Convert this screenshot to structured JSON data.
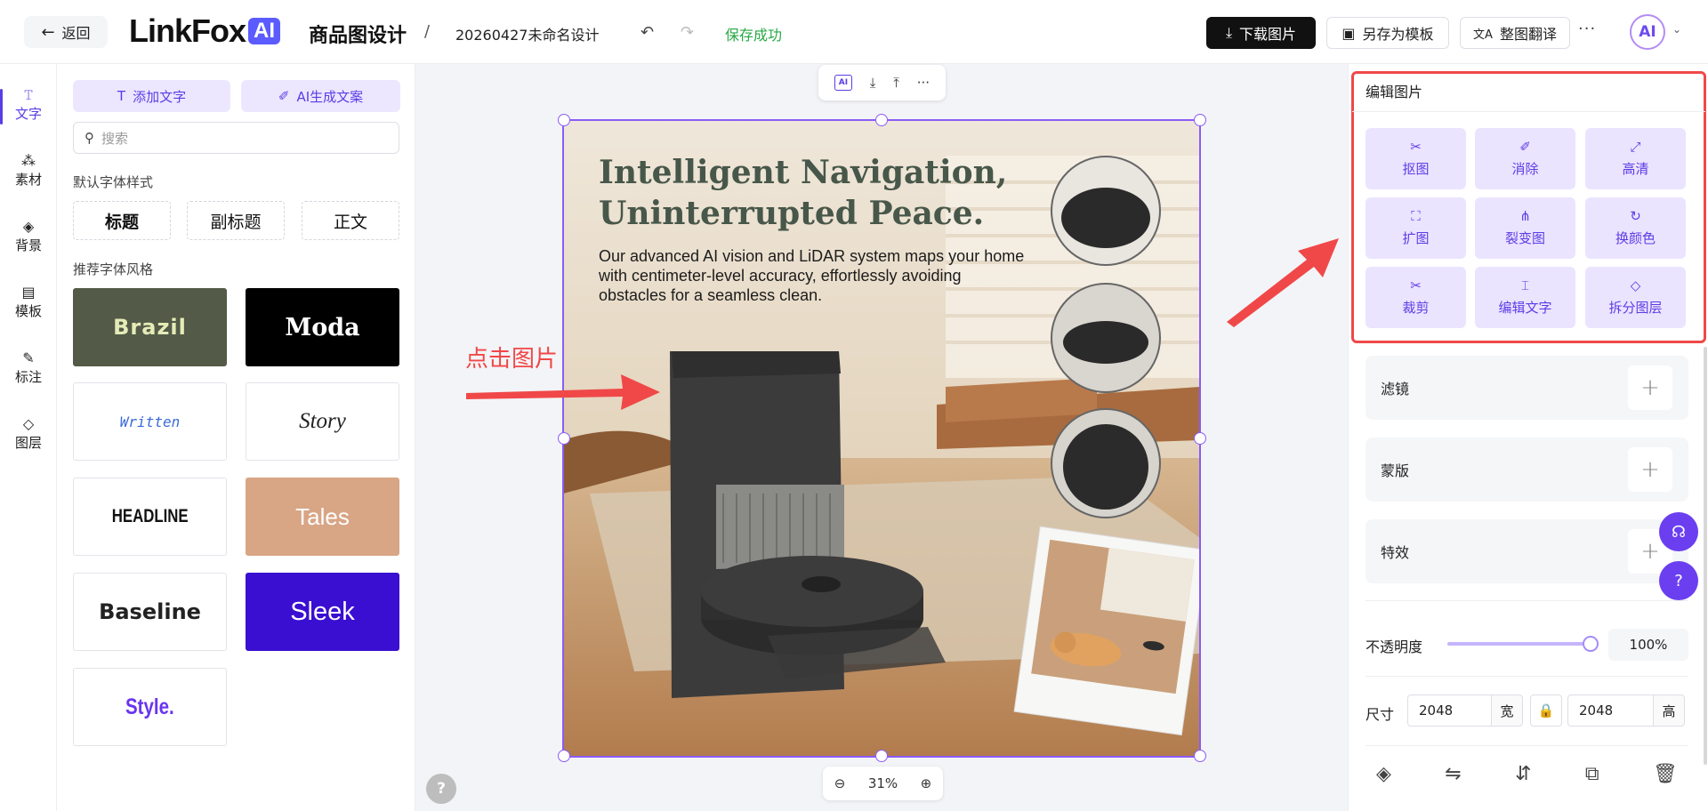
{
  "header": {
    "back_label": "返回",
    "logo_text": "LinkFox",
    "logo_badge": "AI",
    "app_title": "商品图设计",
    "separator": "/",
    "doc_name": "20260427未命名设计",
    "undo_icon": "undo-icon",
    "redo_icon": "redo-icon",
    "save_status": "保存成功",
    "download_label": "下载图片",
    "save_template_label": "另存为模板",
    "translate_label": "整图翻译",
    "more": "···",
    "avatar_text": "AI"
  },
  "rail": {
    "items": [
      {
        "label": "文字",
        "icon": "text-icon",
        "active": true
      },
      {
        "label": "素材",
        "icon": "assets-icon"
      },
      {
        "label": "背景",
        "icon": "background-icon"
      },
      {
        "label": "模板",
        "icon": "template-icon"
      },
      {
        "label": "标注",
        "icon": "annotate-icon"
      },
      {
        "label": "图层",
        "icon": "layers-icon"
      }
    ]
  },
  "text_panel": {
    "add_text_label": "添加文字",
    "ai_copy_label": "AI生成文案",
    "search_placeholder": "搜索",
    "default_styles_title": "默认字体样式",
    "default_styles": [
      "标题",
      "副标题",
      "正文"
    ],
    "recommended_title": "推荐字体风格",
    "font_styles": [
      "Brazil",
      "Moda",
      "Written",
      "Story",
      "HEADLINE",
      "Tales",
      "Baseline",
      "Sleek",
      "Style."
    ]
  },
  "canvas": {
    "mini_toolbar_ai": "AI",
    "headline_line1": "Intelligent Navigation,",
    "headline_line2": "Uninterrupted Peace.",
    "body_text": "Our advanced AI vision and LiDAR system maps your home with centimeter-level accuracy, effortlessly avoiding obstacles for a seamless clean.",
    "annotation": "点击图片",
    "zoom_level": "31%",
    "help": "?"
  },
  "right_panel": {
    "edit_title": "编辑图片",
    "tools": [
      {
        "label": "抠图",
        "icon": "cutout-icon"
      },
      {
        "label": "消除",
        "icon": "erase-icon"
      },
      {
        "label": "高清",
        "icon": "hd-icon"
      },
      {
        "label": "扩图",
        "icon": "expand-icon"
      },
      {
        "label": "裂变图",
        "icon": "variation-icon"
      },
      {
        "label": "换颜色",
        "icon": "recolor-icon"
      },
      {
        "label": "裁剪",
        "icon": "crop-icon"
      },
      {
        "label": "编辑文字",
        "icon": "edit-text-icon"
      },
      {
        "label": "拆分图层",
        "icon": "split-layers-icon"
      }
    ],
    "filter_label": "滤镜",
    "mask_label": "蒙版",
    "effects_label": "特效",
    "opacity_label": "不透明度",
    "opacity_value": "100%",
    "opacity_fraction": 1.0,
    "size_label": "尺寸",
    "width_value": "2048",
    "width_unit": "宽",
    "height_value": "2048",
    "height_unit": "高"
  },
  "colors": {
    "accent": "#5b3de6",
    "accent_light": "#ebe4ff",
    "annotation_red": "#f04848",
    "success_green": "#27a844"
  }
}
